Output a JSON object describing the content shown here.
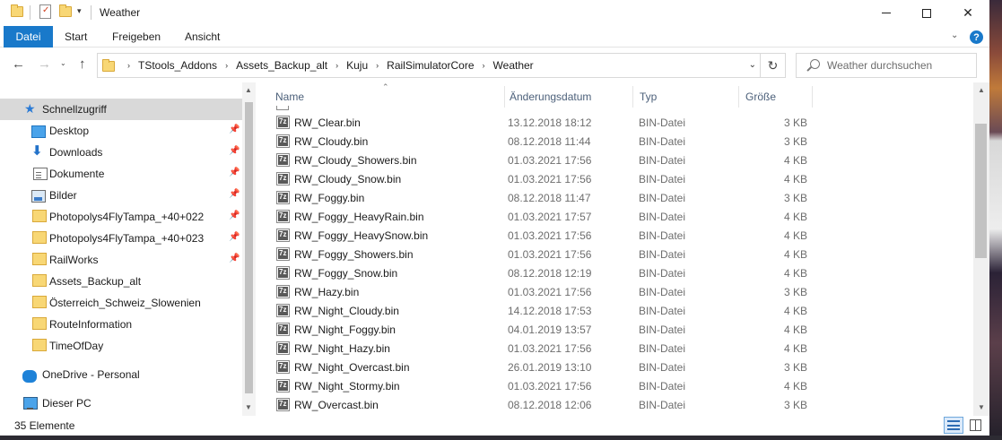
{
  "window": {
    "title": "Weather",
    "controls": {
      "minimize": "",
      "maximize": "",
      "close": "✕"
    }
  },
  "ribbon": {
    "tabs": [
      "Datei",
      "Start",
      "Freigeben",
      "Ansicht"
    ],
    "accent_color": "#1979ca"
  },
  "address": {
    "breadcrumbs": [
      "TStools_Addons",
      "Assets_Backup_alt",
      "Kuju",
      "RailSimulatorCore",
      "Weather"
    ]
  },
  "search": {
    "placeholder": "Weather durchsuchen"
  },
  "nav_pane": {
    "items": [
      {
        "label": "Schnellzugriff",
        "icon": "star-icon",
        "pinned": false,
        "selected": true
      },
      {
        "label": "Desktop",
        "icon": "desktop-icon",
        "pinned": true
      },
      {
        "label": "Downloads",
        "icon": "download-icon",
        "pinned": true
      },
      {
        "label": "Dokumente",
        "icon": "documents-icon",
        "pinned": true
      },
      {
        "label": "Bilder",
        "icon": "pictures-icon",
        "pinned": true
      },
      {
        "label": "Photopolys4FlyTampa_+40+022",
        "icon": "folder-icon",
        "pinned": true
      },
      {
        "label": "Photopolys4FlyTampa_+40+023",
        "icon": "folder-icon",
        "pinned": true
      },
      {
        "label": "RailWorks",
        "icon": "folder-icon",
        "pinned": true
      },
      {
        "label": "Assets_Backup_alt",
        "icon": "folder-icon",
        "pinned": false
      },
      {
        "label": "Österreich_Schweiz_Slowenien",
        "icon": "folder-icon",
        "pinned": false
      },
      {
        "label": "RouteInformation",
        "icon": "folder-icon",
        "pinned": false
      },
      {
        "label": "TimeOfDay",
        "icon": "folder-icon",
        "pinned": false
      },
      {
        "label": "OneDrive - Personal",
        "icon": "cloud-icon",
        "pinned": false
      },
      {
        "label": "Dieser PC",
        "icon": "computer-icon",
        "pinned": false
      }
    ]
  },
  "file_list": {
    "columns": [
      "Name",
      "Änderungsdatum",
      "Typ",
      "Größe"
    ],
    "rows": [
      {
        "name": "RW_Clear.bin",
        "date": "13.12.2018 18:12",
        "type": "BIN-Datei",
        "size": "3 KB"
      },
      {
        "name": "RW_Cloudy.bin",
        "date": "08.12.2018 11:44",
        "type": "BIN-Datei",
        "size": "3 KB"
      },
      {
        "name": "RW_Cloudy_Showers.bin",
        "date": "01.03.2021 17:56",
        "type": "BIN-Datei",
        "size": "4 KB"
      },
      {
        "name": "RW_Cloudy_Snow.bin",
        "date": "01.03.2021 17:56",
        "type": "BIN-Datei",
        "size": "4 KB"
      },
      {
        "name": "RW_Foggy.bin",
        "date": "08.12.2018 11:47",
        "type": "BIN-Datei",
        "size": "3 KB"
      },
      {
        "name": "RW_Foggy_HeavyRain.bin",
        "date": "01.03.2021 17:57",
        "type": "BIN-Datei",
        "size": "4 KB"
      },
      {
        "name": "RW_Foggy_HeavySnow.bin",
        "date": "01.03.2021 17:56",
        "type": "BIN-Datei",
        "size": "4 KB"
      },
      {
        "name": "RW_Foggy_Showers.bin",
        "date": "01.03.2021 17:56",
        "type": "BIN-Datei",
        "size": "4 KB"
      },
      {
        "name": "RW_Foggy_Snow.bin",
        "date": "08.12.2018 12:19",
        "type": "BIN-Datei",
        "size": "4 KB"
      },
      {
        "name": "RW_Hazy.bin",
        "date": "01.03.2021 17:56",
        "type": "BIN-Datei",
        "size": "3 KB"
      },
      {
        "name": "RW_Night_Cloudy.bin",
        "date": "14.12.2018 17:53",
        "type": "BIN-Datei",
        "size": "4 KB"
      },
      {
        "name": "RW_Night_Foggy.bin",
        "date": "04.01.2019 13:57",
        "type": "BIN-Datei",
        "size": "4 KB"
      },
      {
        "name": "RW_Night_Hazy.bin",
        "date": "01.03.2021 17:56",
        "type": "BIN-Datei",
        "size": "4 KB"
      },
      {
        "name": "RW_Night_Overcast.bin",
        "date": "26.01.2019 13:10",
        "type": "BIN-Datei",
        "size": "3 KB"
      },
      {
        "name": "RW_Night_Stormy.bin",
        "date": "01.03.2021 17:56",
        "type": "BIN-Datei",
        "size": "4 KB"
      },
      {
        "name": "RW_Overcast.bin",
        "date": "08.12.2018 12:06",
        "type": "BIN-Datei",
        "size": "3 KB"
      }
    ]
  },
  "status": {
    "item_count": "35 Elemente"
  }
}
